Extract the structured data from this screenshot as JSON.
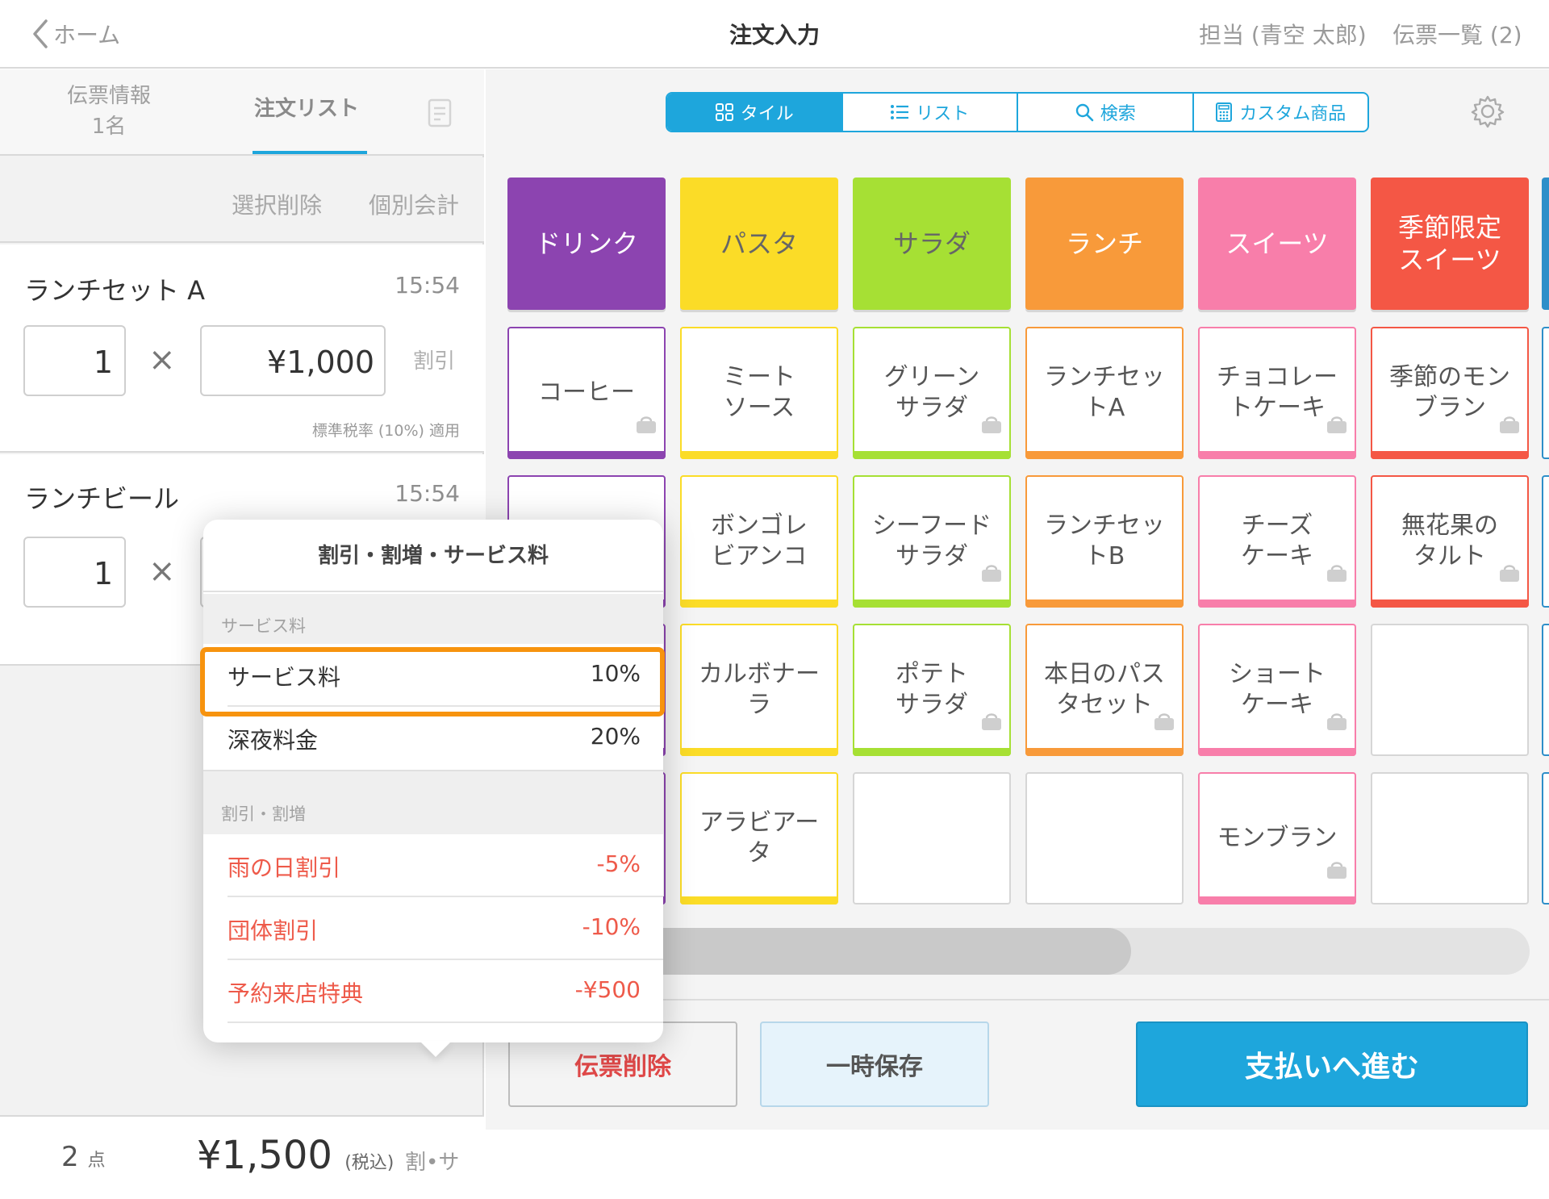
{
  "topbar": {
    "back_label": "ホーム",
    "title": "注文入力",
    "staff": "担当 (青空 太郎)",
    "slips": "伝票一覧 (2)"
  },
  "left_tabs": {
    "info_label": "伝票情報",
    "info_count": "1名",
    "order_label": "注文リスト"
  },
  "left_actions": {
    "delete_selected": "選択削除",
    "separate_bill": "個別会計"
  },
  "order_items": [
    {
      "name": "ランチセット A",
      "time": "15:54",
      "qty": "1",
      "price": "¥1,000",
      "discount_label": "割引",
      "tax_note": "標準税率 (10%) 適用"
    },
    {
      "name": "ランチビール",
      "time": "15:54",
      "qty": "1"
    }
  ],
  "left_footer": {
    "count": "2",
    "count_unit": "点",
    "total": "¥1,500",
    "tax_incl": "(税込)",
    "wari": "割•サ"
  },
  "segment": [
    {
      "label": "タイル",
      "icon": "grid-icon",
      "active": true
    },
    {
      "label": "リスト",
      "icon": "list-icon",
      "active": false
    },
    {
      "label": "検索",
      "icon": "search-icon",
      "active": false
    },
    {
      "label": "カスタム商品",
      "icon": "calculator-icon",
      "active": false
    }
  ],
  "categories": [
    {
      "label": "ドリンク",
      "color": "#8c44b0"
    },
    {
      "label": "パスタ",
      "color": "#fbdc27",
      "text_color": "#666666"
    },
    {
      "label": "サラダ",
      "color": "#a6e034",
      "text_color": "#666666"
    },
    {
      "label": "ランチ",
      "color": "#f89a3a"
    },
    {
      "label": "スイーツ",
      "color": "#f87eaa"
    },
    {
      "label": "季節限定\nスイーツ",
      "color": "#f45745"
    }
  ],
  "products": [
    [
      "コーヒー",
      "",
      "",
      "",
      "",
      ""
    ],
    [
      "ミート\nソース",
      "ボンゴレ\nビアンコ",
      "カルボナー\nラ",
      "アラビアー\nタ"
    ],
    [
      "グリーン\nサラダ",
      "シーフード\nサラダ",
      "ポテト\nサラダ"
    ],
    [
      "ランチセッ\nトA",
      "ランチセッ\nトB",
      "本日のパス\nタセット"
    ],
    [
      "チョコレー\nトケーキ",
      "チーズ\nケーキ",
      "ショート\nケーキ",
      "モンブラン"
    ],
    [
      "季節のモン\nブラン",
      "無花果の\nタルト"
    ]
  ],
  "bottom_buttons": {
    "delete": "伝票削除",
    "save": "一時保存",
    "pay": "支払いへ進む"
  },
  "popover": {
    "title": "割引・割増・サービス料",
    "service_section": "サービス料",
    "service_rows": [
      {
        "label": "サービス料",
        "value": "10%"
      },
      {
        "label": "深夜料金",
        "value": "20%"
      }
    ],
    "discount_section": "割引・割増",
    "discount_rows": [
      {
        "label": "雨の日割引",
        "value": "-5%"
      },
      {
        "label": "団体割引",
        "value": "-10%"
      },
      {
        "label": "予約来店特典",
        "value": "-¥500"
      }
    ]
  },
  "colors": {
    "accent": "#1ea6dc",
    "highlight": "#f7930e",
    "discount_red": "#ee5a4a"
  }
}
